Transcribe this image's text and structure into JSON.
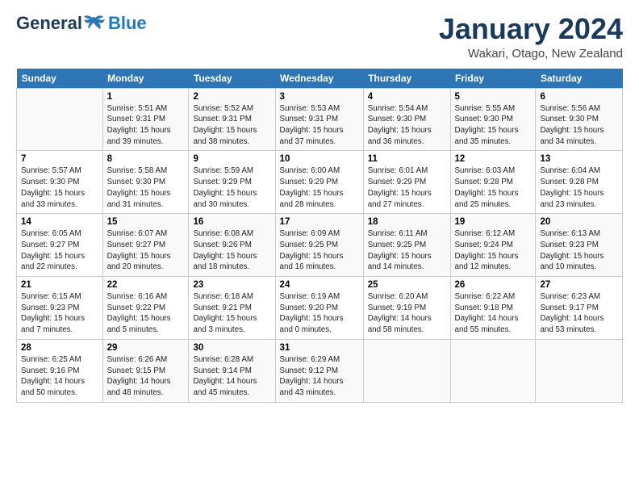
{
  "logo": {
    "general": "General",
    "blue": "Blue"
  },
  "title": "January 2024",
  "subtitle": "Wakari, Otago, New Zealand",
  "weekdays": [
    "Sunday",
    "Monday",
    "Tuesday",
    "Wednesday",
    "Thursday",
    "Friday",
    "Saturday"
  ],
  "weeks": [
    [
      {
        "day": "",
        "info": ""
      },
      {
        "day": "1",
        "info": "Sunrise: 5:51 AM\nSunset: 9:31 PM\nDaylight: 15 hours\nand 39 minutes."
      },
      {
        "day": "2",
        "info": "Sunrise: 5:52 AM\nSunset: 9:31 PM\nDaylight: 15 hours\nand 38 minutes."
      },
      {
        "day": "3",
        "info": "Sunrise: 5:53 AM\nSunset: 9:31 PM\nDaylight: 15 hours\nand 37 minutes."
      },
      {
        "day": "4",
        "info": "Sunrise: 5:54 AM\nSunset: 9:30 PM\nDaylight: 15 hours\nand 36 minutes."
      },
      {
        "day": "5",
        "info": "Sunrise: 5:55 AM\nSunset: 9:30 PM\nDaylight: 15 hours\nand 35 minutes."
      },
      {
        "day": "6",
        "info": "Sunrise: 5:56 AM\nSunset: 9:30 PM\nDaylight: 15 hours\nand 34 minutes."
      }
    ],
    [
      {
        "day": "7",
        "info": "Sunrise: 5:57 AM\nSunset: 9:30 PM\nDaylight: 15 hours\nand 33 minutes."
      },
      {
        "day": "8",
        "info": "Sunrise: 5:58 AM\nSunset: 9:30 PM\nDaylight: 15 hours\nand 31 minutes."
      },
      {
        "day": "9",
        "info": "Sunrise: 5:59 AM\nSunset: 9:29 PM\nDaylight: 15 hours\nand 30 minutes."
      },
      {
        "day": "10",
        "info": "Sunrise: 6:00 AM\nSunset: 9:29 PM\nDaylight: 15 hours\nand 28 minutes."
      },
      {
        "day": "11",
        "info": "Sunrise: 6:01 AM\nSunset: 9:29 PM\nDaylight: 15 hours\nand 27 minutes."
      },
      {
        "day": "12",
        "info": "Sunrise: 6:03 AM\nSunset: 9:28 PM\nDaylight: 15 hours\nand 25 minutes."
      },
      {
        "day": "13",
        "info": "Sunrise: 6:04 AM\nSunset: 9:28 PM\nDaylight: 15 hours\nand 23 minutes."
      }
    ],
    [
      {
        "day": "14",
        "info": "Sunrise: 6:05 AM\nSunset: 9:27 PM\nDaylight: 15 hours\nand 22 minutes."
      },
      {
        "day": "15",
        "info": "Sunrise: 6:07 AM\nSunset: 9:27 PM\nDaylight: 15 hours\nand 20 minutes."
      },
      {
        "day": "16",
        "info": "Sunrise: 6:08 AM\nSunset: 9:26 PM\nDaylight: 15 hours\nand 18 minutes."
      },
      {
        "day": "17",
        "info": "Sunrise: 6:09 AM\nSunset: 9:25 PM\nDaylight: 15 hours\nand 16 minutes."
      },
      {
        "day": "18",
        "info": "Sunrise: 6:11 AM\nSunset: 9:25 PM\nDaylight: 15 hours\nand 14 minutes."
      },
      {
        "day": "19",
        "info": "Sunrise: 6:12 AM\nSunset: 9:24 PM\nDaylight: 15 hours\nand 12 minutes."
      },
      {
        "day": "20",
        "info": "Sunrise: 6:13 AM\nSunset: 9:23 PM\nDaylight: 15 hours\nand 10 minutes."
      }
    ],
    [
      {
        "day": "21",
        "info": "Sunrise: 6:15 AM\nSunset: 9:23 PM\nDaylight: 15 hours\nand 7 minutes."
      },
      {
        "day": "22",
        "info": "Sunrise: 6:16 AM\nSunset: 9:22 PM\nDaylight: 15 hours\nand 5 minutes."
      },
      {
        "day": "23",
        "info": "Sunrise: 6:18 AM\nSunset: 9:21 PM\nDaylight: 15 hours\nand 3 minutes."
      },
      {
        "day": "24",
        "info": "Sunrise: 6:19 AM\nSunset: 9:20 PM\nDaylight: 15 hours\nand 0 minutes."
      },
      {
        "day": "25",
        "info": "Sunrise: 6:20 AM\nSunset: 9:19 PM\nDaylight: 14 hours\nand 58 minutes."
      },
      {
        "day": "26",
        "info": "Sunrise: 6:22 AM\nSunset: 9:18 PM\nDaylight: 14 hours\nand 55 minutes."
      },
      {
        "day": "27",
        "info": "Sunrise: 6:23 AM\nSunset: 9:17 PM\nDaylight: 14 hours\nand 53 minutes."
      }
    ],
    [
      {
        "day": "28",
        "info": "Sunrise: 6:25 AM\nSunset: 9:16 PM\nDaylight: 14 hours\nand 50 minutes."
      },
      {
        "day": "29",
        "info": "Sunrise: 6:26 AM\nSunset: 9:15 PM\nDaylight: 14 hours\nand 48 minutes."
      },
      {
        "day": "30",
        "info": "Sunrise: 6:28 AM\nSunset: 9:14 PM\nDaylight: 14 hours\nand 45 minutes."
      },
      {
        "day": "31",
        "info": "Sunrise: 6:29 AM\nSunset: 9:12 PM\nDaylight: 14 hours\nand 43 minutes."
      },
      {
        "day": "",
        "info": ""
      },
      {
        "day": "",
        "info": ""
      },
      {
        "day": "",
        "info": ""
      }
    ]
  ]
}
